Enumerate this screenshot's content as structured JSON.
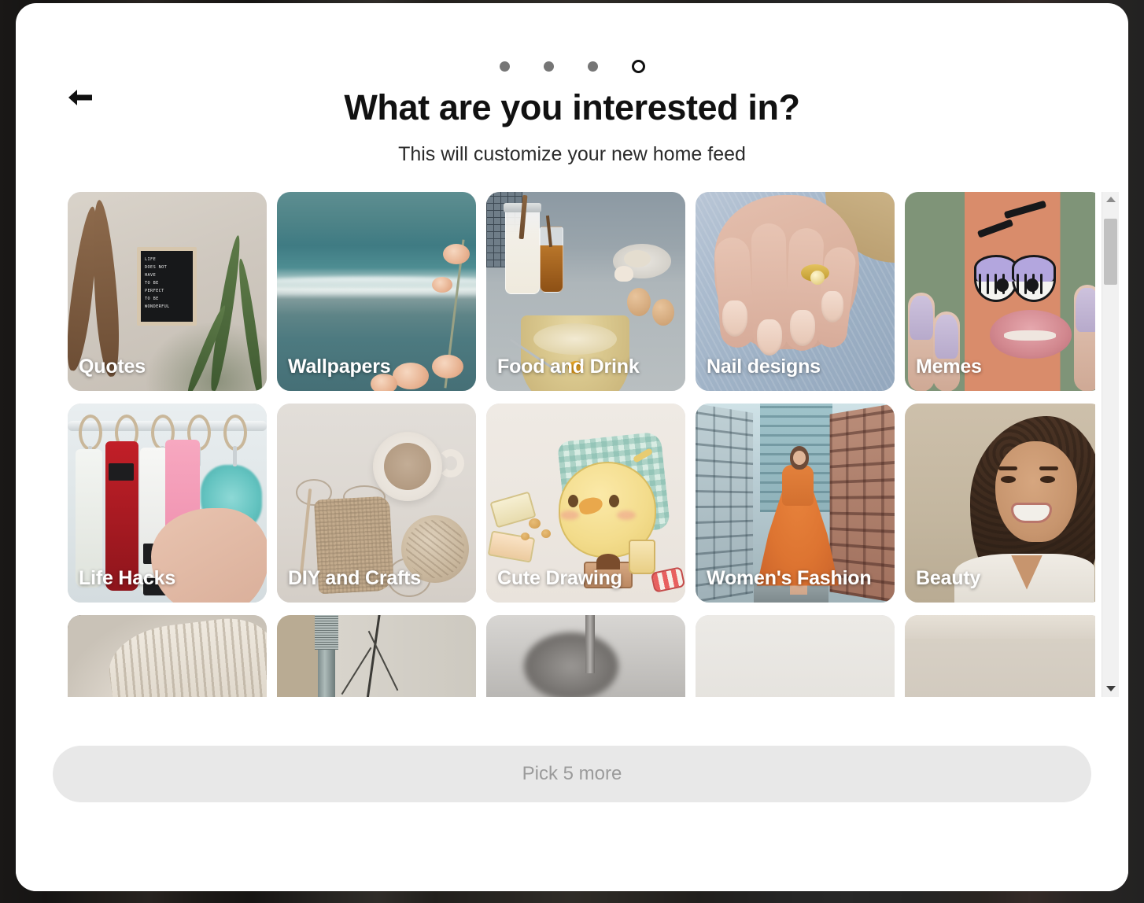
{
  "modal": {
    "title": "What are you interested in?",
    "subtitle": "This will customize your new home feed",
    "back_label": "Back",
    "back_icon": "arrow-left-icon"
  },
  "progress": {
    "total_steps": 4,
    "current_step": 4,
    "steps": [
      {
        "state": "done"
      },
      {
        "state": "done"
      },
      {
        "state": "done"
      },
      {
        "state": "current"
      }
    ]
  },
  "grid": {
    "rows": [
      {
        "cards": [
          {
            "label": "Quotes",
            "art": "art-quotes"
          },
          {
            "label": "Wallpapers",
            "art": "art-wall"
          },
          {
            "label": "Food and Drink",
            "art": "art-food"
          },
          {
            "label": "Nail designs",
            "art": "art-nail"
          },
          {
            "label": "Memes",
            "art": "art-meme"
          }
        ]
      },
      {
        "cards": [
          {
            "label": "Life Hacks",
            "art": "art-life"
          },
          {
            "label": "DIY and Crafts",
            "art": "art-diy"
          },
          {
            "label": "Cute Drawing",
            "art": "art-cute"
          },
          {
            "label": "Women's Fashion",
            "art": "art-fashion"
          },
          {
            "label": "Beauty",
            "art": "art-beauty"
          }
        ]
      },
      {
        "cards": [
          {
            "label": "",
            "art": "art-r3a"
          },
          {
            "label": "",
            "art": "art-r3b"
          },
          {
            "label": "",
            "art": "art-r3c"
          },
          {
            "label": "",
            "art": "art-r3d"
          },
          {
            "label": "",
            "art": "art-r3e"
          }
        ]
      }
    ]
  },
  "quote_board": {
    "lines": [
      "LIFE",
      "DOES NOT",
      "HAVE",
      "TO BE",
      "PERFECT",
      "TO BE",
      "WONDERFUL"
    ]
  },
  "footer": {
    "cta_label": "Pick 5 more",
    "cta_enabled": false
  },
  "scrollbar": {
    "up_icon": "chevron-up-icon",
    "down_icon": "chevron-down-icon"
  },
  "colors": {
    "page_background": "#2b2b2b",
    "modal_background": "#ffffff",
    "title": "#111111",
    "dot_done": "#767676",
    "dot_current": "#111111",
    "cta_background": "#e8e8e8",
    "cta_text": "#9b9b9b",
    "card_label": "#ffffff",
    "scrollbar_thumb": "#c1c1c1",
    "scrollbar_track": "#f1f1f1"
  }
}
